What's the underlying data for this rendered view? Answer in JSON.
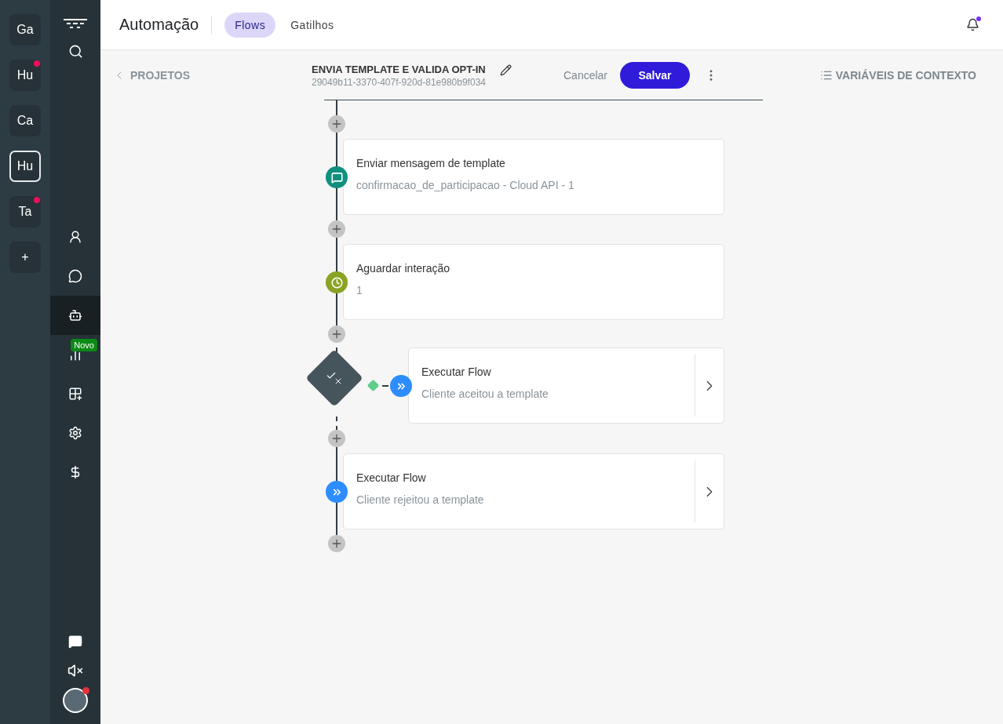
{
  "workspaces": [
    {
      "label": "Ga",
      "dot": false,
      "selected": false
    },
    {
      "label": "Hu",
      "dot": true,
      "selected": false
    },
    {
      "label": "Ca",
      "dot": false,
      "selected": false
    },
    {
      "label": "Hu",
      "dot": false,
      "selected": true
    },
    {
      "label": "Ta",
      "dot": true,
      "selected": false
    },
    {
      "label": "+",
      "dot": false,
      "selected": false
    }
  ],
  "nav": [
    {
      "kind": "contacts",
      "selected": false
    },
    {
      "kind": "chat",
      "selected": false
    },
    {
      "kind": "bot",
      "selected": true
    },
    {
      "kind": "reports",
      "selected": false,
      "badge": "Novo"
    },
    {
      "kind": "apps",
      "selected": false
    },
    {
      "kind": "settings",
      "selected": false
    },
    {
      "kind": "billing",
      "selected": false
    }
  ],
  "topbar": {
    "title": "Automação",
    "tabs": [
      {
        "label": "Flows",
        "selected": true
      },
      {
        "label": "Gatilhos",
        "selected": false
      }
    ],
    "notification": true
  },
  "header": {
    "back": "PROJETOS",
    "flow_name": "ENVIA TEMPLATE E VALIDA OPT-IN",
    "flow_id": "29049b11-3370-407f-920d-81e980b9f034",
    "cancel": "Cancelar",
    "save": "Salvar",
    "variables": "VARIÁVEIS DE CONTEXTO"
  },
  "steps": [
    {
      "kind": "template",
      "title": "Enviar mensagem de template",
      "subtitle": "confirmacao_de_participacao - Cloud API - 1",
      "expandable": false
    },
    {
      "kind": "wait",
      "title": "Aguardar interação",
      "subtitle": "1",
      "expandable": false
    },
    {
      "kind": "condition",
      "title": "Executar Flow",
      "subtitle": "Cliente aceitou a template",
      "expandable": true
    },
    {
      "kind": "flow",
      "title": "Executar Flow",
      "subtitle": "Cliente rejeitou a template",
      "expandable": true
    }
  ]
}
